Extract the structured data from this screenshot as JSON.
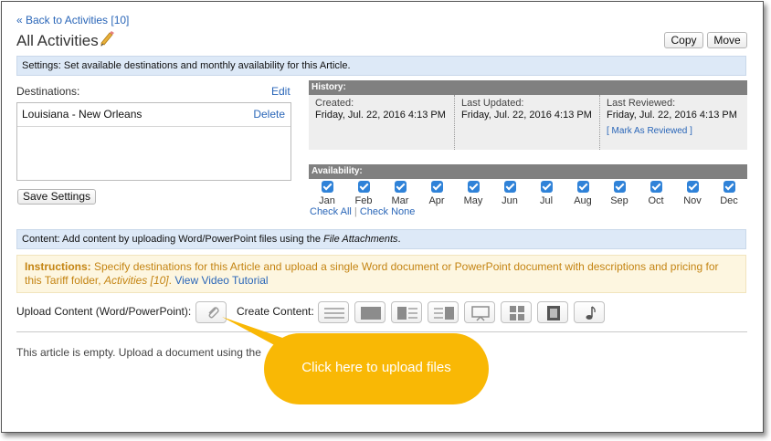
{
  "nav": {
    "back_link": "« Back to Activities [10]"
  },
  "page": {
    "title": "All Activities"
  },
  "toolbar": {
    "copy_label": "Copy",
    "move_label": "Move"
  },
  "settings_band": "Settings: Set available destinations and monthly availability for this Article.",
  "destinations": {
    "label": "Destinations:",
    "edit_label": "Edit",
    "items": [
      {
        "name": "Louisiana - New Orleans",
        "delete_label": "Delete"
      }
    ],
    "save_label": "Save Settings"
  },
  "history": {
    "header": "History:",
    "columns": [
      {
        "label": "Created:",
        "value": "Friday, Jul. 22, 2016 4:13 PM"
      },
      {
        "label": "Last Updated:",
        "value": "Friday, Jul. 22, 2016 4:13 PM"
      },
      {
        "label": "Last Reviewed:",
        "value": "Friday, Jul. 22, 2016 4:13 PM",
        "link": "[ Mark As Reviewed ]"
      }
    ]
  },
  "availability": {
    "header": "Availability:",
    "months": [
      {
        "label": "Jan",
        "checked": true
      },
      {
        "label": "Feb",
        "checked": true
      },
      {
        "label": "Mar",
        "checked": true
      },
      {
        "label": "Apr",
        "checked": true
      },
      {
        "label": "May",
        "checked": true
      },
      {
        "label": "Jun",
        "checked": true
      },
      {
        "label": "Jul",
        "checked": true
      },
      {
        "label": "Aug",
        "checked": true
      },
      {
        "label": "Sep",
        "checked": true
      },
      {
        "label": "Oct",
        "checked": true
      },
      {
        "label": "Nov",
        "checked": true
      },
      {
        "label": "Dec",
        "checked": true
      }
    ],
    "check_all": "Check All",
    "separator": "|",
    "check_none": "Check None"
  },
  "content_band": {
    "text": "Content: Add content by uploading Word/PowerPoint files using the ",
    "emphasis": "File Attachments",
    "suffix": "."
  },
  "instructions": {
    "label": "Instructions:",
    "text": " Specify destinations for this Article and upload a single Word document or PowerPoint document with descriptions and pricing for this Tariff folder, ",
    "folder": "Activities [10]",
    "after_folder": ". ",
    "video_link": "View Video Tutorial"
  },
  "upload": {
    "label": "Upload Content (Word/PowerPoint):",
    "icon": "paperclip-icon",
    "create_label": "Create Content:",
    "tools": [
      "text-block-icon",
      "image-block-icon",
      "image-left-text-icon",
      "image-right-text-icon",
      "slideshow-icon",
      "gallery-grid-icon",
      "video-film-icon",
      "music-note-icon"
    ]
  },
  "empty_message": "This article is empty. Upload a document using the",
  "callout": {
    "text": "Click here to upload files",
    "color": "#f9b805"
  },
  "colors": {
    "accent": "#2a66b8",
    "band": "#dde9f7",
    "header_bar": "#808080",
    "instructions": "#c48412",
    "checkbox": "#2f82d8"
  }
}
